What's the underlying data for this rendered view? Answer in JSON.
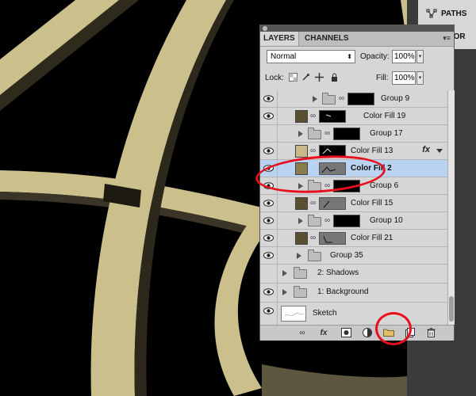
{
  "right_panel": {
    "paths_label": "PATHS",
    "history_label": "STOR"
  },
  "panel": {
    "tabs": [
      {
        "label": "LAYERS"
      },
      {
        "label": "CHANNELS"
      }
    ],
    "blend_mode": "Normal",
    "opacity_label": "Opacity:",
    "opacity_value": "100%",
    "lock_label": "Lock:",
    "fill_label": "Fill:",
    "fill_value": "100%",
    "layers": [
      {
        "name": "Group 9"
      },
      {
        "name": "Color Fill 19"
      },
      {
        "name": "Group 17"
      },
      {
        "name": "Color Fill 13",
        "fx": "fx"
      },
      {
        "name": "Color Fill 2"
      },
      {
        "name": "Group 6"
      },
      {
        "name": "Color Fill 15"
      },
      {
        "name": "Group 10"
      },
      {
        "name": "Color Fill 21"
      },
      {
        "name": "Group 35"
      },
      {
        "name": "2: Shadows"
      },
      {
        "name": "1: Background"
      },
      {
        "name": "Sketch"
      }
    ],
    "bottom_icons": [
      "link-icon",
      "fx-icon",
      "mask-icon",
      "adjustment-icon",
      "new-group-icon",
      "new-layer-icon",
      "trash-icon"
    ],
    "bottom_fx": "fx"
  },
  "colors": {
    "stroke_tan": "#cbbf8c",
    "swatch_tan": "#c9b888",
    "swatch_olive": "#5a4f30",
    "selection_blue": "#b9d3f0",
    "annotation_red": "#e8101c"
  }
}
